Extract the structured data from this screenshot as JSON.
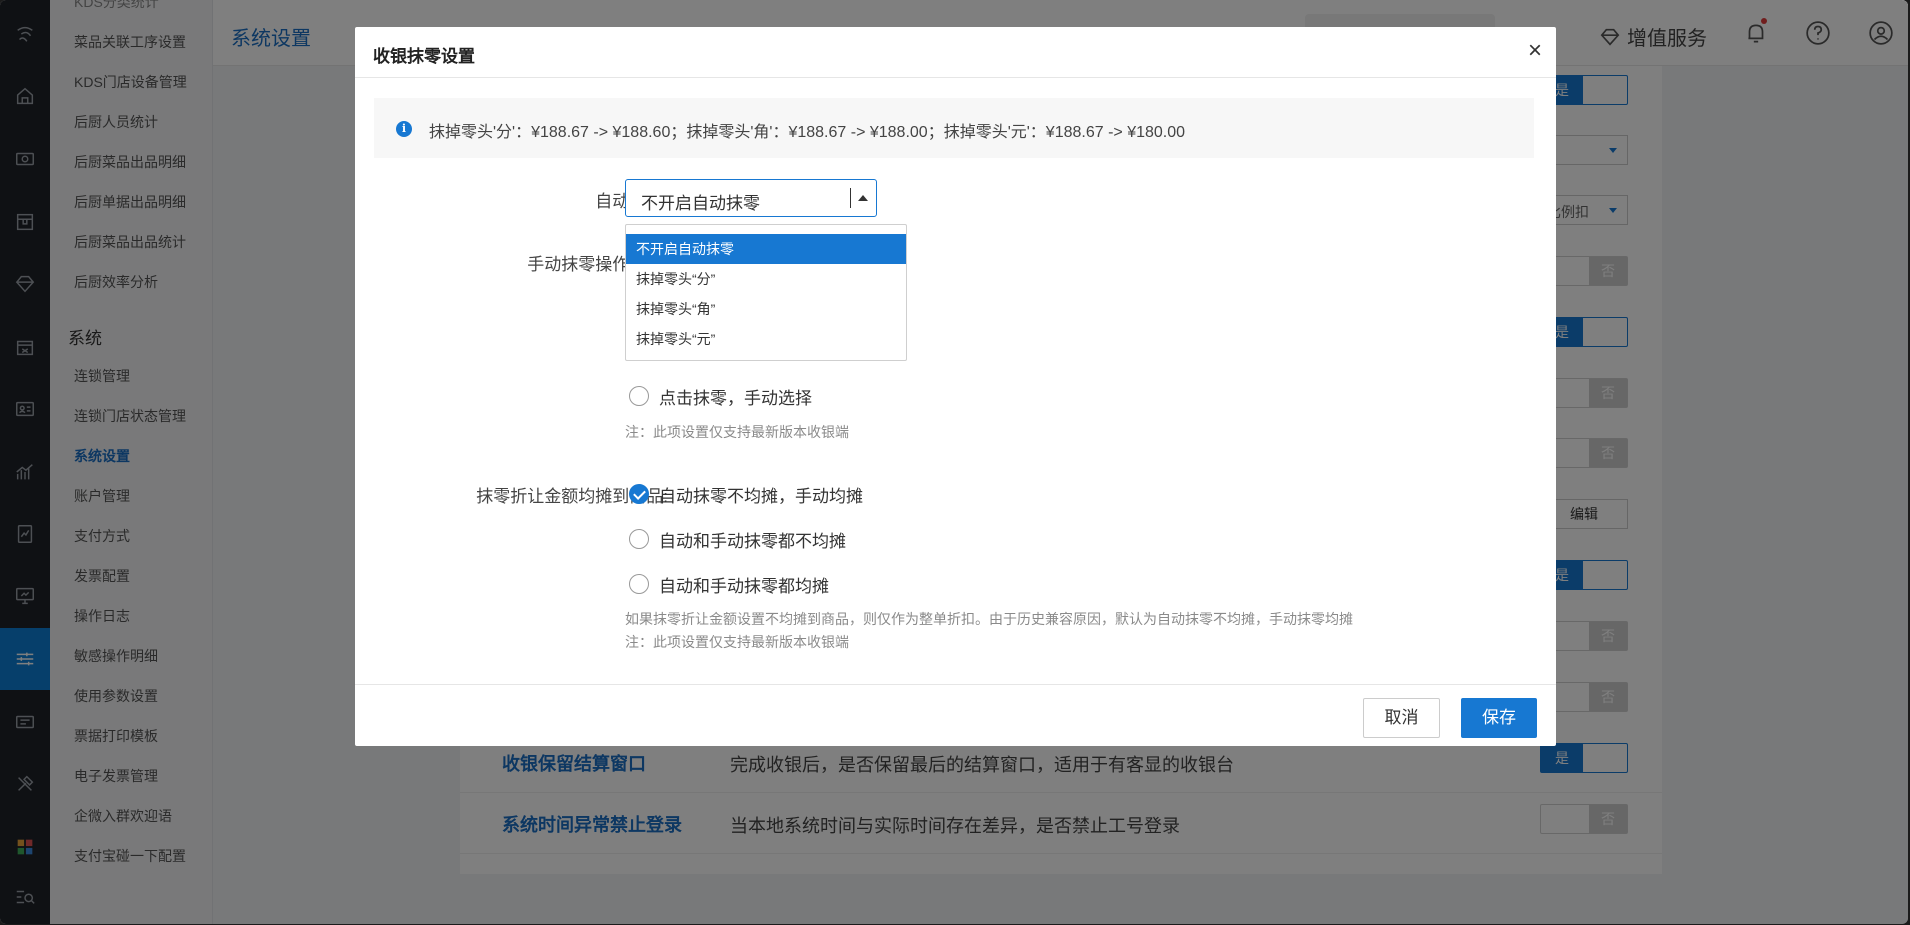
{
  "header": {
    "title": "系统设置",
    "value_added_label": "增值服务"
  },
  "subnav": {
    "items_top": [
      "KDS分类统计",
      "菜品关联工序设置",
      "KDS门店设备管理",
      "后厨人员统计",
      "后厨菜品出品明细",
      "后厨单据出品明细",
      "后厨菜品出品统计",
      "后厨效率分析"
    ],
    "section_title": "系统",
    "items": [
      "连锁管理",
      "连锁门店状态管理",
      "系统设置",
      "账户管理",
      "支付方式",
      "发票配置",
      "操作日志",
      "敏感操作明细",
      "使用参数设置",
      "票据打印模板",
      "电子发票管理",
      "企微入群欢迎语",
      "支付宝碰一下配置"
    ],
    "active_item": "系统设置"
  },
  "background": {
    "toggle_yes": "是",
    "toggle_no": "否",
    "select_partial": "比例扣",
    "edit_label": "编辑",
    "rows": [
      {
        "title": "收银保留结算窗口",
        "desc": "完成收银后，是否保留最后的结算窗口，适用于有客显的收银台"
      },
      {
        "title": "系统时间异常禁止登录",
        "desc": "当本地系统时间与实际时间存在差异，是否禁止工号登录"
      }
    ]
  },
  "modal": {
    "title": "收银抹零设置",
    "close_glyph": "×",
    "info": "抹掉零头'分'：¥188.67 -> ¥188.60；抹掉零头'角'：¥188.67 -> ¥188.00；抹掉零头'元'：¥188.67 -> ¥180.00",
    "auto_round": {
      "label": "自动抹零:",
      "value": "不开启自动抹零",
      "options": [
        "不开启自动抹零",
        "抹掉零头“分”",
        "抹掉零头“角”",
        "抹掉零头“元”"
      ],
      "selected_index": 0
    },
    "manual_round": {
      "label": "手动抹零操作方式:",
      "visible_option": "点击抹零，手动选择",
      "note": "注：此项设置仅支持最新版本收银端"
    },
    "apportion": {
      "label": "抹零折让金额均摊到商品:",
      "options": [
        "自动抹零不均摊，手动均摊",
        "自动和手动抹零都不均摊",
        "自动和手动抹零都均摊"
      ],
      "selected_index": 0,
      "note1": "如果抹零折让金额设置不均摊到商品，则仅作为整单折扣。由于历史兼容原因，默认为自动抹零不均摊，手动抹零均摊",
      "note2": "注：此项设置仅支持最新版本收银端"
    },
    "cancel_label": "取消",
    "save_label": "保存"
  }
}
